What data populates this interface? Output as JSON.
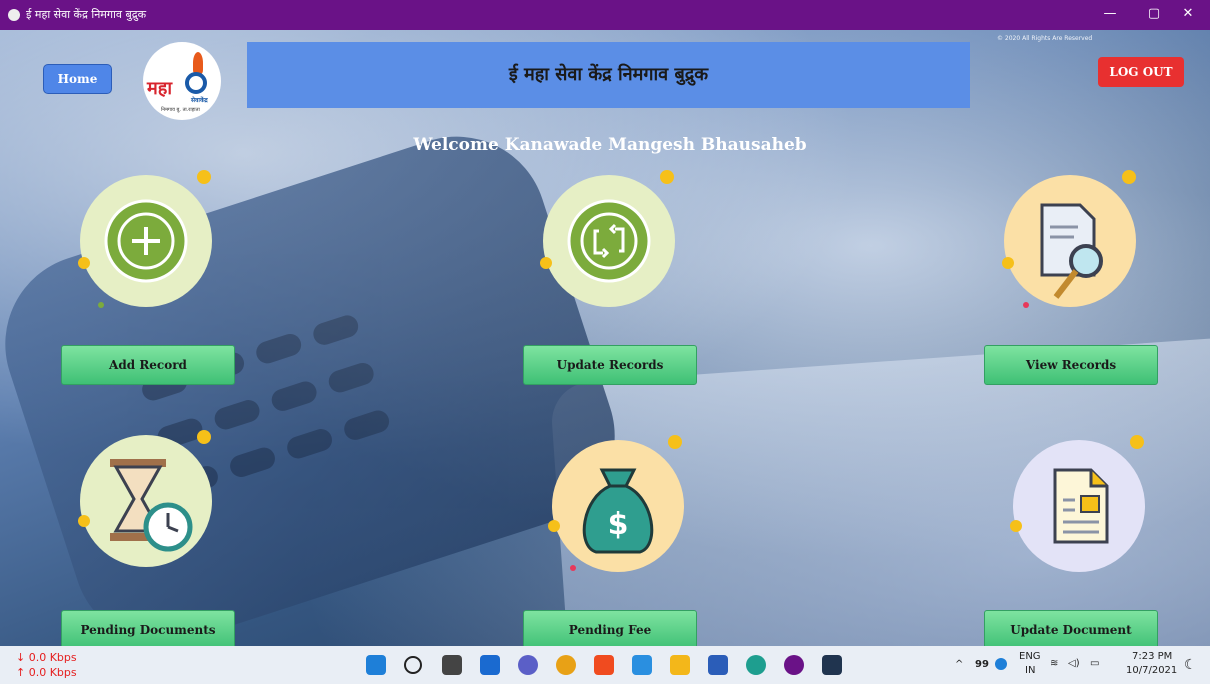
{
  "window": {
    "title": "ई महा सेवा केंद्र निमगाव बुद्रुक",
    "minimize": "—",
    "maximize": "▢",
    "close": "✕"
  },
  "header": {
    "home_label": "Home",
    "logo": {
      "main": "महा",
      "sub": "सेवाकेंद्र",
      "sub2": "निमगाव बु. ता.राहाता"
    },
    "banner_title": "ई महा सेवा केंद्र निमगाव बुद्रुक",
    "copyright": "© 2020 All Rights Are Reserved",
    "logout_label": "LOG OUT"
  },
  "welcome": "Welcome Kanawade Mangesh Bhausaheb",
  "tiles": [
    {
      "label": "Add Record",
      "icon": "plus-icon",
      "bg": "#e6efc5"
    },
    {
      "label": "Update Records",
      "icon": "refresh-icon",
      "bg": "#e6efc5"
    },
    {
      "label": "View Records",
      "icon": "search-document-icon",
      "bg": "#fbe0a6"
    },
    {
      "label": "Pending Documents",
      "icon": "hourglass-clock-icon",
      "bg": "#e6efc5"
    },
    {
      "label": "Pending Fee",
      "icon": "money-bag-icon",
      "bg": "#fbe0a6"
    },
    {
      "label": "Update Document",
      "icon": "document-icon",
      "bg": "#e3e3f7"
    }
  ],
  "taskbar": {
    "download_speed": "↓ 0.0 Kbps",
    "upload_speed": "↑ 0.0 Kbps",
    "tray_count": "99",
    "lang": "ENG",
    "region": "IN",
    "time": "7:23 PM",
    "date": "10/7/2021"
  },
  "colors": {
    "titlebar": "#6a1287",
    "banner": "#5b8ee6",
    "home": "#4f86e8",
    "logout": "#e83030",
    "action": "#4cc97f"
  }
}
